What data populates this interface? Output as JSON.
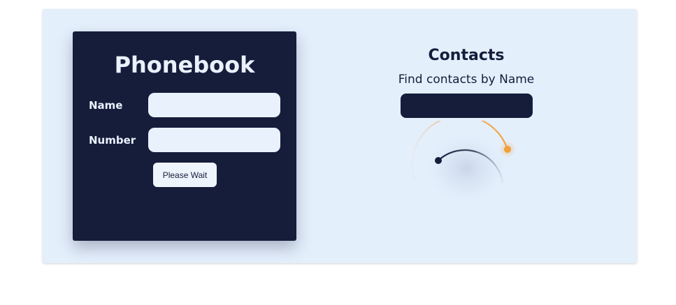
{
  "phonebook": {
    "title": "Phonebook",
    "name_label": "Name",
    "name_value": "",
    "number_label": "Number",
    "number_value": "",
    "submit_label": "Please Wait"
  },
  "contacts": {
    "title": "Contacts",
    "filter_label": "Find contacts by Name",
    "filter_value": ""
  },
  "colors": {
    "dark": "#151d3b",
    "light": "#e4effc",
    "accent": "#f0a03c"
  },
  "loader": {
    "icon": "loading-spinner-icon"
  }
}
